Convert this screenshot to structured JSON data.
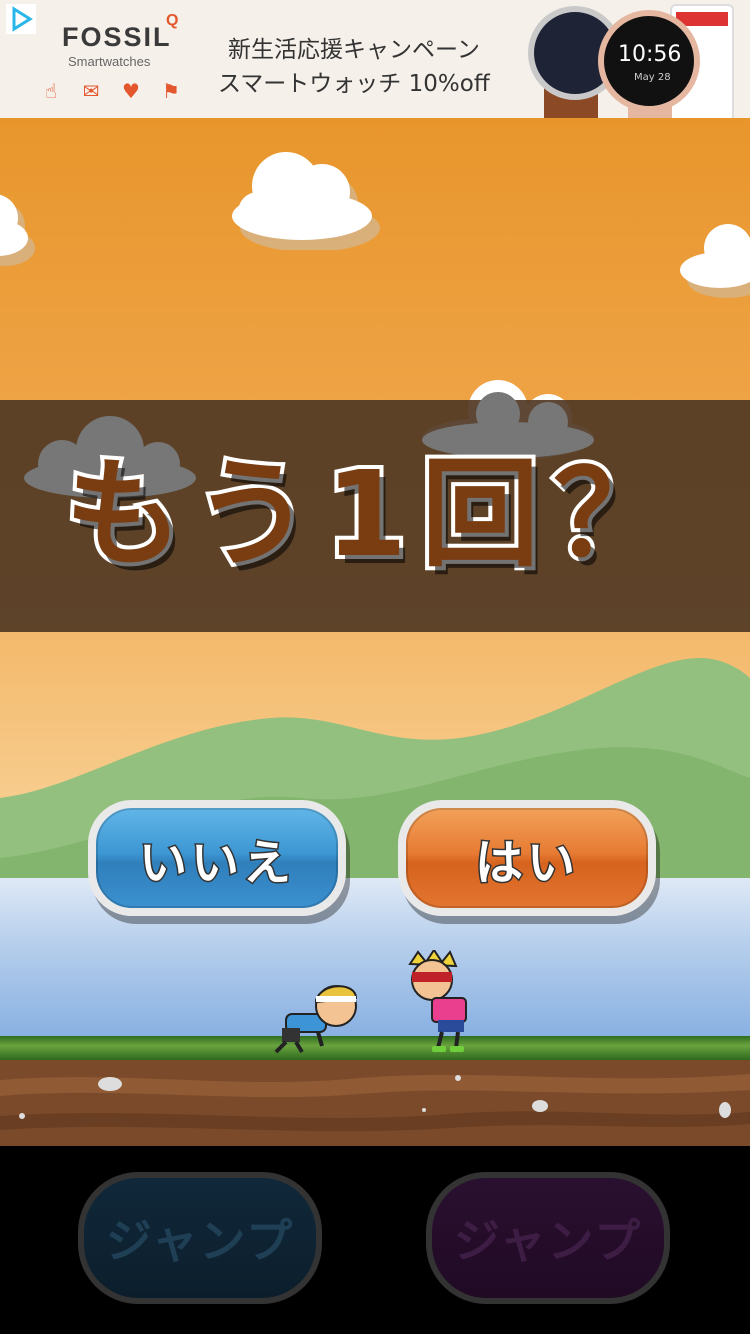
{
  "ad": {
    "brand": "FOSSIL",
    "brand_mark": "Q",
    "brand_sub": "Smartwatches",
    "copy_line1": "新生活応援キャンペーン",
    "copy_line2": "スマートウォッチ 10%off",
    "watch_time": "10:56",
    "watch_date": "May 28",
    "icons": [
      "touch-icon",
      "message-icon",
      "heart-rate-icon",
      "running-icon"
    ]
  },
  "dialog": {
    "title": "もう1回？",
    "no_label": "いいえ",
    "yes_label": "はい"
  },
  "controls": {
    "left_jump_label": "ジャンプ",
    "right_jump_label": "ジャンプ"
  },
  "colors": {
    "sky_top": "#e8962c",
    "no_button": "#3d97d3",
    "yes_button": "#e77b33"
  }
}
